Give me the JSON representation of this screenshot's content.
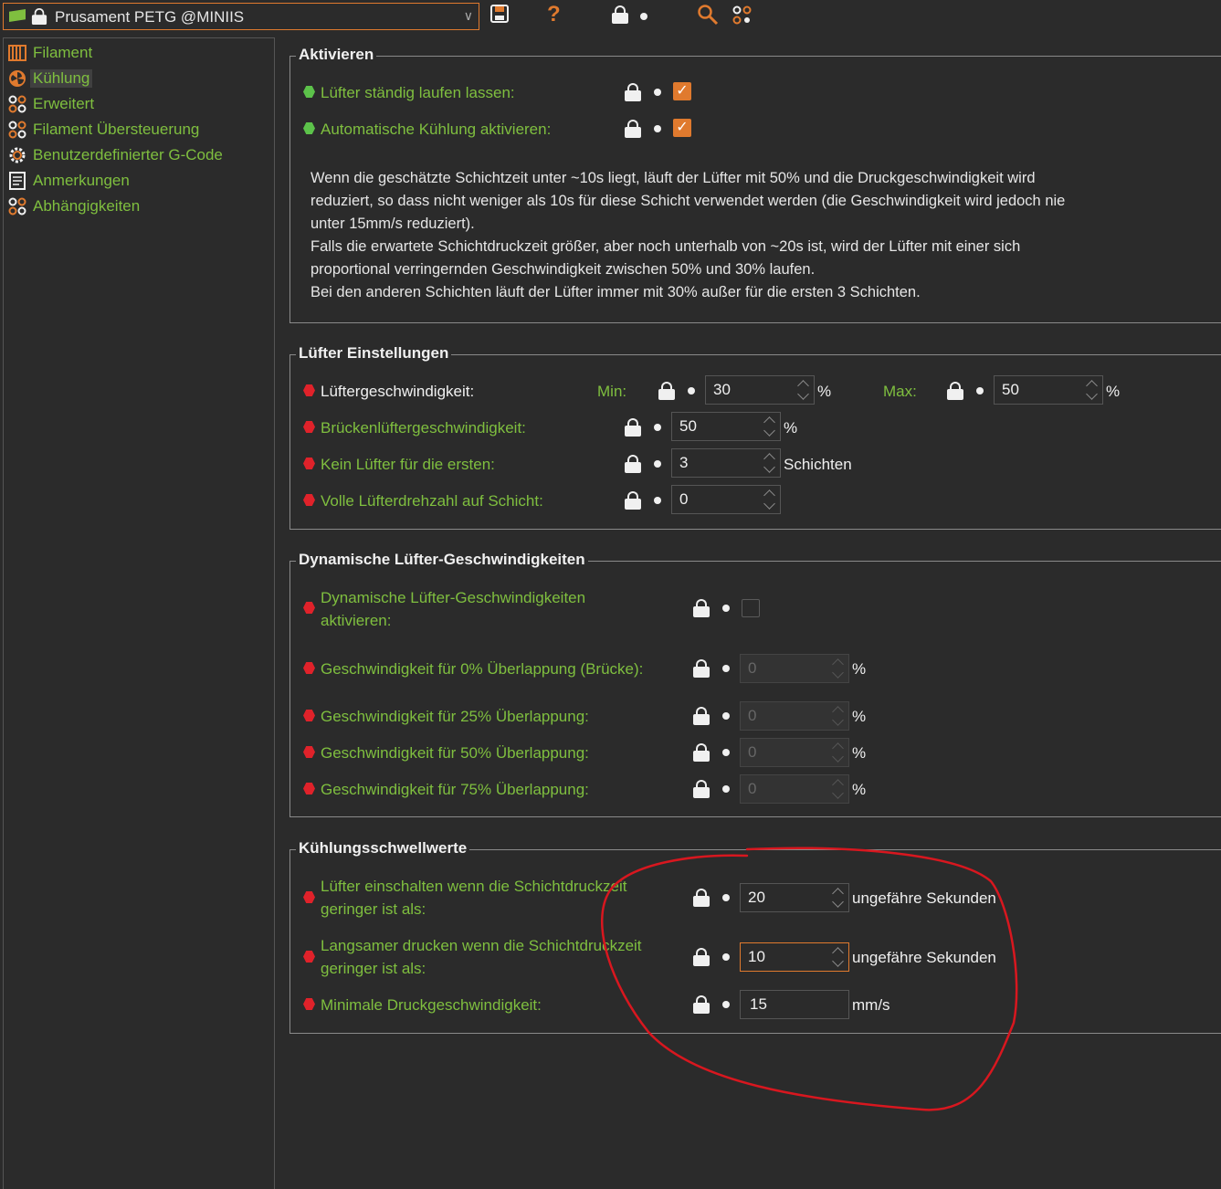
{
  "toolbar": {
    "preset_name": "Prusament PETG @MINIIS",
    "icons": [
      "save-icon",
      "help-icon",
      "lock-icon",
      "search-icon",
      "compare-icon"
    ],
    "help_glyph": "?"
  },
  "sidebar": {
    "items": [
      {
        "label": "Filament",
        "icon": "filament-icon"
      },
      {
        "label": "Kühlung",
        "icon": "fan-icon",
        "selected": true
      },
      {
        "label": "Erweitert",
        "icon": "wrench-icon"
      },
      {
        "label": "Filament Übersteuerung",
        "icon": "wrench-icon"
      },
      {
        "label": "Benutzerdefinierter G-Code",
        "icon": "gear-icon"
      },
      {
        "label": "Anmerkungen",
        "icon": "notes-icon"
      },
      {
        "label": "Abhängigkeiten",
        "icon": "wrench-icon"
      }
    ]
  },
  "aktivieren": {
    "title": "Aktivieren",
    "fan_always_on": {
      "label": "Lüfter ständig laufen lassen:",
      "checked": true
    },
    "auto_cooling": {
      "label": "Automatische Kühlung aktivieren:",
      "checked": true
    },
    "description": [
      "Wenn die geschätzte Schichtzeit unter  ~10s liegt, läuft der Lüfter mit 50% und die Druckgeschwindigkeit wird",
      "reduziert, so dass nicht weniger als 10s für diese Schicht verwendet werden (die Geschwindigkeit wird jedoch nie",
      "unter 15mm/s reduziert).",
      "Falls die erwartete Schichtdruckzeit größer, aber noch unterhalb von ~20s ist, wird der Lüfter mit einer sich",
      "proportional verringernden Geschwindigkeit zwischen 50% und 30% laufen.",
      "Bei den anderen Schichten läuft der Lüfter immer mit 30% außer für die ersten 3 Schichten."
    ]
  },
  "luefter": {
    "title": "Lüfter Einstellungen",
    "speed": {
      "label": "Lüftergeschwindigkeit:",
      "min_label": "Min:",
      "min_value": "30",
      "max_label": "Max:",
      "max_value": "50",
      "unit": "%"
    },
    "bridge": {
      "label": "Brückenlüftergeschwindigkeit:",
      "value": "50",
      "unit": "%"
    },
    "first_layers": {
      "label": "Kein Lüfter für die ersten:",
      "value": "3",
      "unit": "Schichten"
    },
    "full_speed": {
      "label": "Volle Lüfterdrehzahl auf Schicht:",
      "value": "0"
    }
  },
  "dynamisch": {
    "title": "Dynamische Lüfter-Geschwindigkeiten",
    "enable": {
      "label_1": "Dynamische Lüfter-Geschwindigkeiten",
      "label_2": "aktivieren:",
      "checked": false
    },
    "overlap_0": {
      "label": "Geschwindigkeit für 0% Überlappung (Brücke):",
      "value": "0",
      "unit": "%"
    },
    "overlap_25": {
      "label": "Geschwindigkeit für 25% Überlappung:",
      "value": "0",
      "unit": "%"
    },
    "overlap_50": {
      "label": "Geschwindigkeit für 50% Überlappung:",
      "value": "0",
      "unit": "%"
    },
    "overlap_75": {
      "label": "Geschwindigkeit für 75% Überlappung:",
      "value": "0",
      "unit": "%"
    }
  },
  "schwellwerte": {
    "title": "Kühlungsschwellwerte",
    "fan_below": {
      "label_1": "Lüfter einschalten wenn die Schichtdruckzeit",
      "label_2": "geringer ist als:",
      "value": "20",
      "unit": "ungefähre Sekunden"
    },
    "slow_below": {
      "label_1": "Langsamer drucken wenn die Schichtdruckzeit",
      "label_2": "geringer ist als:",
      "value": "10",
      "unit": "ungefähre Sekunden"
    },
    "min_speed": {
      "label": "Minimale Druckgeschwindigkeit:",
      "value": "15",
      "unit": "mm/s"
    }
  },
  "colors": {
    "accent": "#e07a2e",
    "label_green": "#7fbf3f",
    "required_red": "#e0222a",
    "annotation_red": "#d8171f",
    "background": "#2b2b2b"
  }
}
